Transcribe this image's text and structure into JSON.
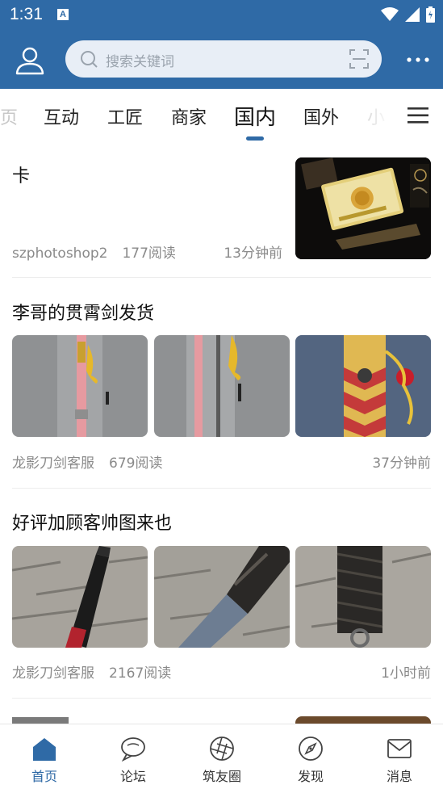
{
  "status_bar": {
    "time": "1:31",
    "badge": "A"
  },
  "header": {
    "search_placeholder": "搜索关键词",
    "icons": [
      "user-icon",
      "search-icon",
      "scan-icon",
      "more-icon"
    ]
  },
  "tabs": {
    "items": [
      "页",
      "互动",
      "工匠",
      "商家",
      "国内",
      "国外",
      "小"
    ],
    "active": "国内"
  },
  "feed": {
    "posts": [
      {
        "title": "卡",
        "author": "szphotoshop2",
        "reads": "177阅读",
        "time": "13分钟前",
        "images": 1
      },
      {
        "title": "李哥的贯霄剑发货",
        "author": "龙影刀剑客服",
        "reads": "679阅读",
        "time": "37分钟前",
        "images": 3
      },
      {
        "title": "好评加顾客帅图来也",
        "author": "龙影刀剑客服",
        "reads": "2167阅读",
        "time": "1小时前",
        "images": 3
      }
    ]
  },
  "bottom_nav": {
    "items": [
      {
        "label": "首页",
        "icon": "home-icon",
        "active": true
      },
      {
        "label": "论坛",
        "icon": "chat-bubble-icon"
      },
      {
        "label": "筑友圈",
        "icon": "aperture-icon"
      },
      {
        "label": "发现",
        "icon": "compass-icon"
      },
      {
        "label": "消息",
        "icon": "mail-icon"
      }
    ]
  },
  "colors": {
    "primary": "#2f6aa6",
    "search_bg": "#e8eef6",
    "meta": "#8a8a8a"
  }
}
